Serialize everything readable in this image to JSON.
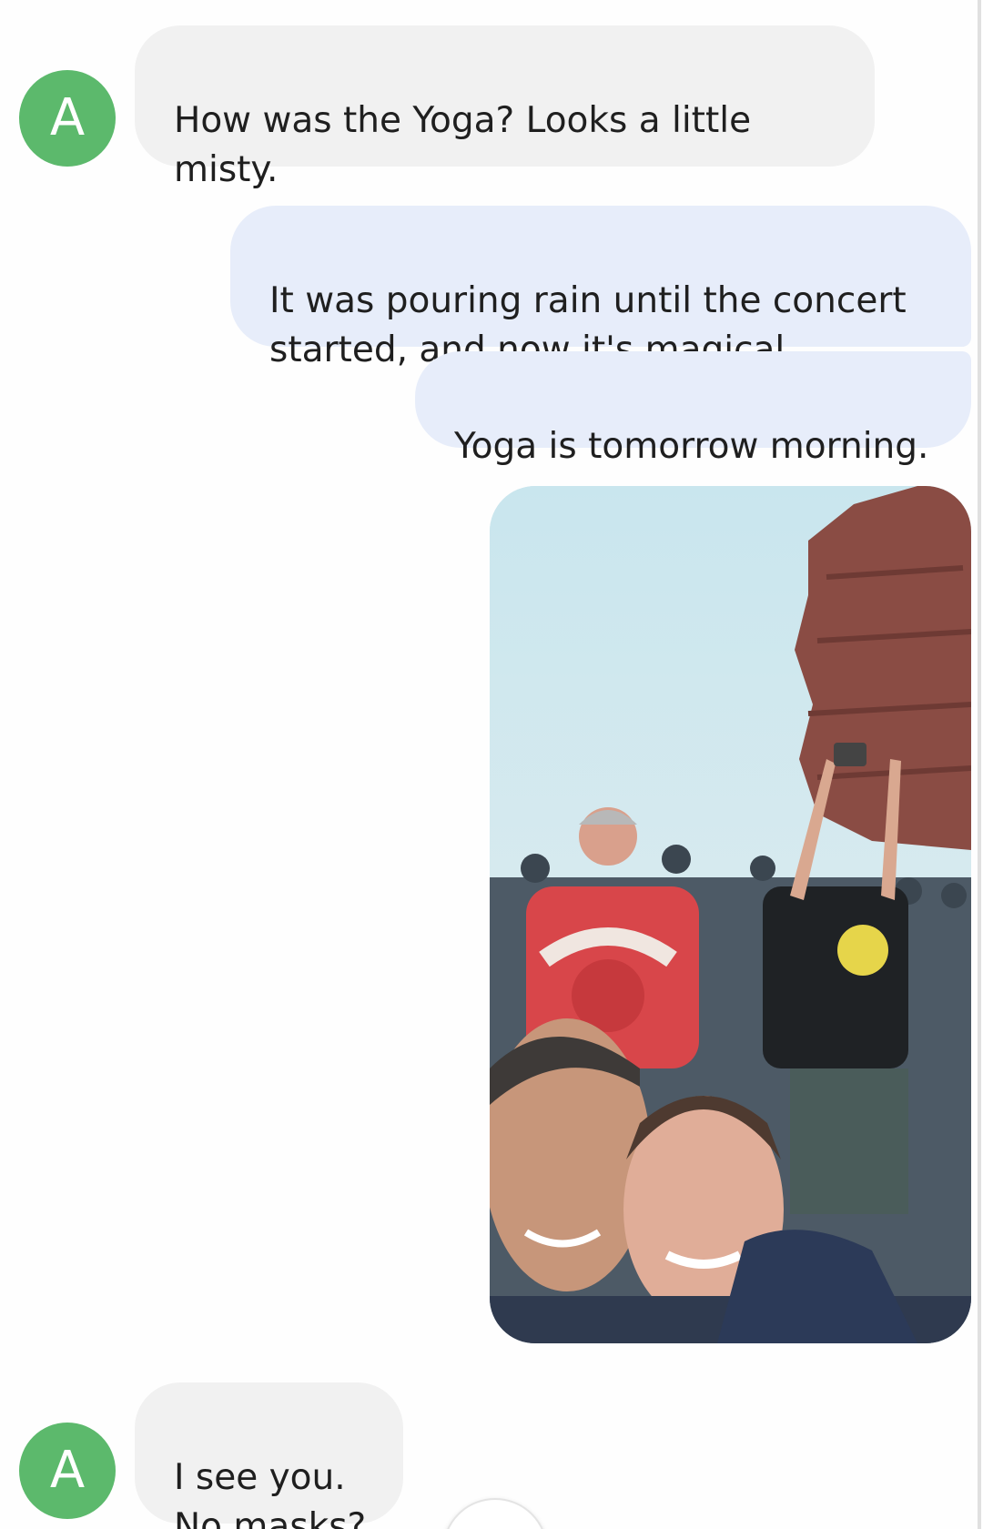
{
  "contact": {
    "initial": "A",
    "avatar_color": "#5cb96c"
  },
  "messages": [
    {
      "direction": "incoming",
      "text": "How was the Yoga?  Looks a little\nmisty."
    },
    {
      "direction": "outgoing",
      "text": "It was pouring rain until the concert\nstarted, and now it's magical"
    },
    {
      "direction": "outgoing",
      "text": "Yoga is tomorrow morning."
    },
    {
      "direction": "outgoing",
      "type": "image",
      "description_icon": "photo-selfie-concert"
    },
    {
      "direction": "incoming",
      "text": "I see you.\nNo masks?"
    }
  ],
  "colors": {
    "incoming_bubble": "#f1f1f1",
    "outgoing_bubble": "#e7edfa",
    "text": "#1f1f1f"
  },
  "scroll_to_bottom": {
    "icon": "arrow-down-icon"
  }
}
